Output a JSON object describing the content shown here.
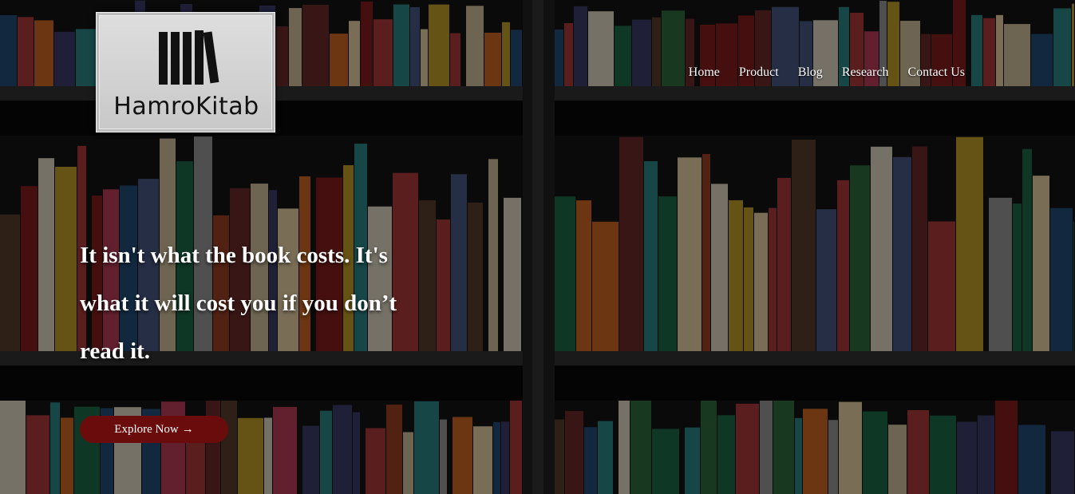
{
  "brand": {
    "name": "HamroKitab",
    "logo_icon": "bookshelf-icon"
  },
  "nav": {
    "items": [
      {
        "label": "Home"
      },
      {
        "label": "Product"
      },
      {
        "label": "Blog"
      },
      {
        "label": "Research"
      },
      {
        "label": "Contact Us"
      }
    ]
  },
  "hero": {
    "quote": "It isn't what the book costs. It's what it will cost you if you don’t read it.",
    "cta_label": "Explore Now",
    "cta_arrow": "→"
  },
  "colors": {
    "cta_background": "#6a0c0c",
    "nav_text": "#ffffff",
    "logo_background": "#d4d4d4"
  },
  "background": {
    "image": "bookshelf-photo"
  }
}
